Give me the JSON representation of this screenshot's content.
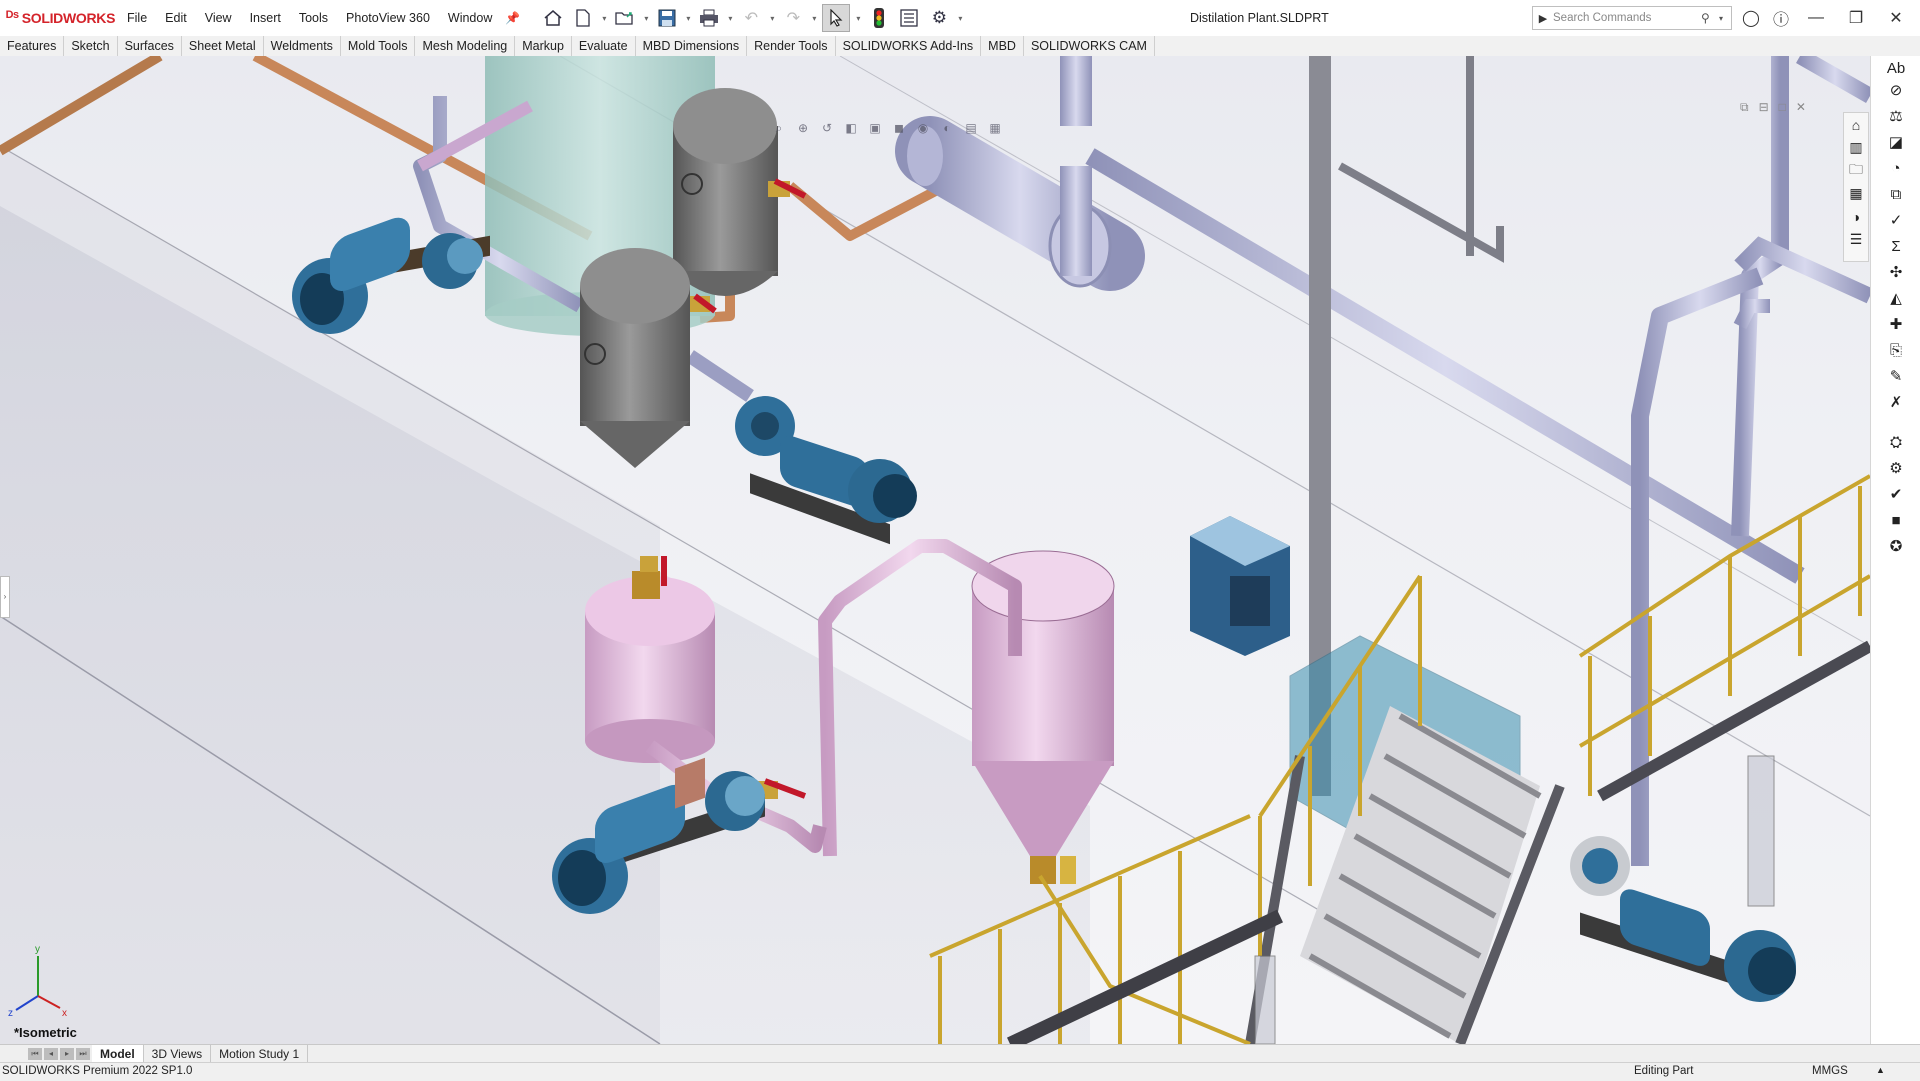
{
  "app": {
    "name": "SOLIDWORKS"
  },
  "menu": {
    "items": [
      "File",
      "Edit",
      "View",
      "Insert",
      "Tools",
      "PhotoView 360",
      "Window"
    ]
  },
  "document": {
    "title": "Distilation Plant.SLDPRT"
  },
  "search": {
    "placeholder": "Search Commands"
  },
  "command_tabs": [
    "Features",
    "Sketch",
    "Surfaces",
    "Sheet Metal",
    "Weldments",
    "Mold Tools",
    "Mesh Modeling",
    "Markup",
    "Evaluate",
    "MBD Dimensions",
    "Render Tools",
    "SOLIDWORKS Add-Ins",
    "MBD",
    "SOLIDWORKS CAM"
  ],
  "viewport": {
    "orientation_label": "*Isometric",
    "triad": {
      "x": "x",
      "y": "y",
      "z": "z"
    }
  },
  "bottom_tabs": [
    "Model",
    "3D Views",
    "Motion Study 1"
  ],
  "status": {
    "product": "SOLIDWORKS Premium 2022 SP1.0",
    "mode": "Editing Part",
    "units": "MMGS"
  },
  "colors": {
    "brand_red": "#d4232a",
    "pipe_violet": "#b9bbd8",
    "vessel_pink": "#e2b8dc",
    "tank_gray": "#7d7d7d",
    "pump_blue": "#2f6f9a",
    "rail_yellow": "#c9a52e",
    "copper": "#c8875a"
  },
  "icons": {
    "quick_access": [
      "home-icon",
      "new-document-icon",
      "open-icon",
      "save-icon",
      "print-icon",
      "undo-icon",
      "redo-icon",
      "select-icon",
      "rebuild-icon",
      "file-properties-icon",
      "options-icon"
    ],
    "task_pane": [
      "resources-icon",
      "design-library-icon",
      "file-explorer-icon",
      "view-palette-icon",
      "appearances-icon",
      "custom-properties-icon"
    ]
  }
}
